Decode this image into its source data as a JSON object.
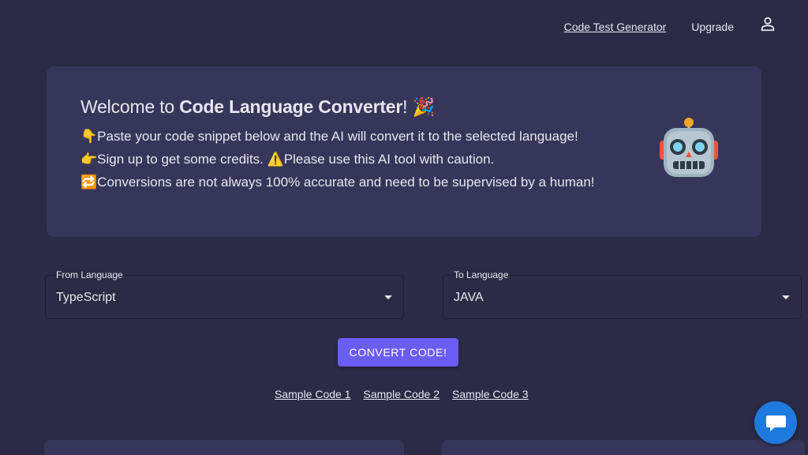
{
  "nav": {
    "code_test_generator": "Code Test Generator",
    "upgrade": "Upgrade"
  },
  "welcome": {
    "title_prefix": "Welcome to ",
    "title_bold": "Code Language Converter",
    "title_suffix": "! 🎉",
    "line1": "👇Paste your code snippet below and the AI will convert it to the selected language!",
    "line2": "👉Sign up to get some credits. ⚠️Please use this AI tool with caution.",
    "line3": "🔁Conversions are not always 100% accurate and need to be supervised by a human!"
  },
  "from_select": {
    "label": "From Language",
    "value": "TypeScript"
  },
  "to_select": {
    "label": "To Language",
    "value": "JAVA"
  },
  "convert_button": "CONVERT CODE!",
  "samples": [
    "Sample Code 1",
    "Sample Code 2",
    "Sample Code 3"
  ],
  "colors": {
    "background": "#2b2b45",
    "card": "#36365a",
    "accent": "#6a5cf6",
    "chat": "#1f7ae0"
  },
  "icons": {
    "user": "user-icon",
    "robot": "robot-icon",
    "chat": "chat-icon"
  }
}
